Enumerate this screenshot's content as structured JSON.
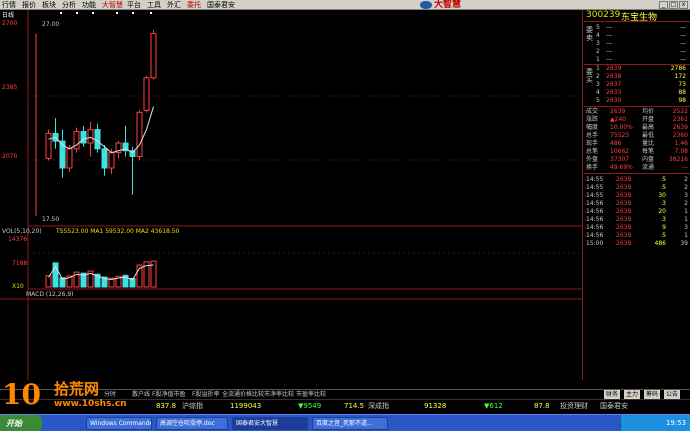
{
  "menubar": {
    "items": [
      "行情",
      "报价",
      "板块",
      "分析",
      "功能",
      "大智慧",
      "平台",
      "工具",
      "外汇",
      "委托",
      "国泰君安"
    ],
    "brand": "大智慧"
  },
  "chart": {
    "period_label": "日线",
    "price_ticks": [
      "2700",
      "2385",
      "2070"
    ],
    "high_label": "27.00",
    "low_label": "17.50",
    "vol_indicator": "VOL(5,10,20)",
    "vol_values": "TS5523.00  MA1 59532.00  MA2 43618.50",
    "vol_ticks": [
      "14376",
      "7188",
      "X10"
    ],
    "macd_label": "MACD (12,26,9)"
  },
  "chart_data": {
    "type": "candlestick",
    "ohlc": [
      {
        "o": 2050,
        "h": 2200,
        "l": 2040,
        "c": 2180
      },
      {
        "o": 2180,
        "h": 2260,
        "l": 2100,
        "c": 2140
      },
      {
        "o": 2140,
        "h": 2200,
        "l": 1950,
        "c": 2000
      },
      {
        "o": 2000,
        "h": 2120,
        "l": 1980,
        "c": 2100
      },
      {
        "o": 2100,
        "h": 2210,
        "l": 2080,
        "c": 2190
      },
      {
        "o": 2190,
        "h": 2220,
        "l": 2110,
        "c": 2130
      },
      {
        "o": 2130,
        "h": 2240,
        "l": 2060,
        "c": 2200
      },
      {
        "o": 2200,
        "h": 2230,
        "l": 2080,
        "c": 2100
      },
      {
        "o": 2100,
        "h": 2120,
        "l": 1960,
        "c": 2000
      },
      {
        "o": 2000,
        "h": 2100,
        "l": 1970,
        "c": 2080
      },
      {
        "o": 2080,
        "h": 2140,
        "l": 2050,
        "c": 2130
      },
      {
        "o": 2130,
        "h": 2220,
        "l": 2060,
        "c": 2090
      },
      {
        "o": 2090,
        "h": 2110,
        "l": 1860,
        "c": 2060
      },
      {
        "o": 2060,
        "h": 2300,
        "l": 2040,
        "c": 2290
      },
      {
        "o": 2300,
        "h": 2480,
        "l": 2290,
        "c": 2470
      },
      {
        "o": 2470,
        "h": 2720,
        "l": 2460,
        "c": 2700
      }
    ],
    "ma": [
      2150,
      2160,
      2120,
      2100,
      2120,
      2150,
      2160,
      2140,
      2110,
      2080,
      2090,
      2100,
      2080,
      2120,
      2200,
      2320
    ],
    "volume": [
      3200,
      6800,
      2600,
      3100,
      4200,
      3900,
      4500,
      3600,
      2800,
      2500,
      3000,
      3300,
      2400,
      6200,
      7100,
      7300
    ],
    "ylim": [
      1750,
      2750
    ],
    "vol_ylim": [
      0,
      14376
    ]
  },
  "panel": {
    "code": "300239",
    "name": "东宝生物",
    "sell_label": "委卖",
    "buy_label": "委买",
    "sell": [
      {
        "n": "5",
        "p": "—",
        "v": "—"
      },
      {
        "n": "4",
        "p": "—",
        "v": "—"
      },
      {
        "n": "3",
        "p": "—",
        "v": "—"
      },
      {
        "n": "2",
        "p": "—",
        "v": "—"
      },
      {
        "n": "1",
        "p": "—",
        "v": "—"
      }
    ],
    "buy": [
      {
        "n": "1",
        "p": "2639",
        "v": "2786"
      },
      {
        "n": "2",
        "p": "2638",
        "v": "172"
      },
      {
        "n": "3",
        "p": "2637",
        "v": "73"
      },
      {
        "n": "4",
        "p": "2633",
        "v": "88"
      },
      {
        "n": "5",
        "p": "2630",
        "v": "98"
      }
    ],
    "stats": [
      {
        "a": "成交",
        "av": "2639",
        "b": "均价",
        "bv": "2522"
      },
      {
        "a": "涨跌",
        "av": "▲240",
        "b": "开盘",
        "bv": "2361"
      },
      {
        "a": "幅度",
        "av": "10.00%",
        "b": "最高",
        "bv": "2639"
      },
      {
        "a": "总手",
        "av": "75523",
        "b": "最低",
        "bv": "2360"
      },
      {
        "a": "现手",
        "av": "486",
        "b": "量比",
        "bv": "1.46"
      },
      {
        "a": "总笔",
        "av": "10662",
        "b": "每笔",
        "bv": "7.08"
      },
      {
        "a": "外盘",
        "av": "37307",
        "b": "内盘",
        "bv": "38216"
      },
      {
        "a": "换手",
        "av": "49.69%",
        "b": "流通",
        "bv": "—"
      }
    ],
    "ticks": [
      {
        "t": "14:55",
        "p": "2639",
        "v": "5",
        "x": "2"
      },
      {
        "t": "14:55",
        "p": "2639",
        "v": "5",
        "x": "2"
      },
      {
        "t": "14:55",
        "p": "2639",
        "v": "30",
        "x": "3"
      },
      {
        "t": "14:56",
        "p": "2639",
        "v": "3",
        "x": "2"
      },
      {
        "t": "14:56",
        "p": "2639",
        "v": "20",
        "x": "1"
      },
      {
        "t": "14:56",
        "p": "2639",
        "v": "3",
        "x": "1"
      },
      {
        "t": "14:56",
        "p": "2639",
        "v": "9",
        "x": "3"
      },
      {
        "t": "14:56",
        "p": "2639",
        "v": "5",
        "x": "1"
      },
      {
        "t": "15:00",
        "p": "2639",
        "v": "486",
        "x": "39"
      }
    ]
  },
  "tabstrip": {
    "tabs": [
      "分时",
      "散户线",
      "F股净值市盈",
      "F股溢折率",
      "全流通价格比较",
      "市净率比较",
      "市盈率比较"
    ],
    "panel_tabs": [
      "财务",
      "主力",
      "筹码",
      "公告"
    ]
  },
  "ticker": {
    "items": [
      {
        "t": "837.8",
        "c": "#ffff40"
      },
      {
        "t": "沪综指",
        "c": "#c8c8c8"
      },
      {
        "t": "1199043",
        "c": "#ffff40"
      },
      {
        "t": "▼9549",
        "c": "#40ff40"
      },
      {
        "t": "714.5",
        "c": "#ffff40"
      },
      {
        "t": "深成指",
        "c": "#c8c8c8"
      },
      {
        "t": "91328",
        "c": "#ffff40"
      },
      {
        "t": "▼612",
        "c": "#40ff40"
      },
      {
        "t": "87.8",
        "c": "#ffff40"
      },
      {
        "t": "投资理财",
        "c": "#c8c8c8"
      },
      {
        "t": "国泰君安",
        "c": "#c8c8c8"
      }
    ]
  },
  "taskbar": {
    "start": "开始",
    "tasks": [
      "Windows Commander 5...",
      "高调空仓吹涨停.doc",
      "国泰君安大智慧",
      "百度之音_死那不道..."
    ],
    "clock": "19:53"
  },
  "watermark": {
    "num": "10",
    "cn": "拾荒网",
    "url": "www.10shs.cn"
  }
}
